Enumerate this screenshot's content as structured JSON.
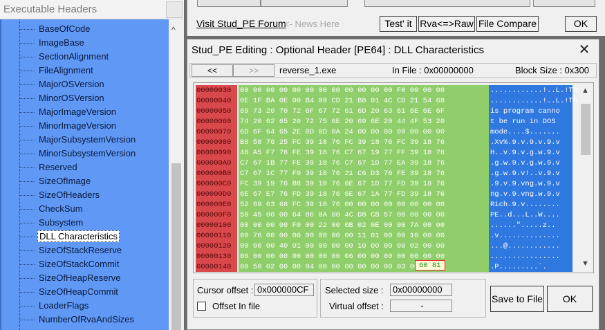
{
  "left_panel": {
    "header": "Executable Headers",
    "tree_items": [
      "BaseOfCode",
      "ImageBase",
      "SectionAlignment",
      "FileAlignment",
      "MajorOSVersion",
      "MinorOSVersion",
      "MajorImageVersion",
      "MinorImageVersion",
      "MajorSubsystemVersion",
      "MinorSubsystemVersion",
      "Reserved",
      "SizeOfImage",
      "SizeOfHeaders",
      "CheckSum",
      "Subsystem",
      "DLL Characteristics",
      "SizeOfStackReserve",
      "SizeOfStackCommit",
      "SizeOfHeapReserve",
      "SizeOfHeapCommit",
      "LoaderFlags",
      "NumberOfRvaAndSizes"
    ],
    "selected_item": "DLL Characteristics",
    "scroll_up_glyph": "^"
  },
  "main_window": {
    "forum_link": "Visit Stud_PE Forum",
    "news_text": "<- News Here",
    "buttons": {
      "test_it": "Test' it",
      "rva_raw": "Rva<=>Raw",
      "file_compare": "File Compare",
      "ok": "OK"
    }
  },
  "dialog": {
    "title": "Stud_PE Editing : Optional Header [PE64] : DLL Characteristics",
    "close_glyph": "✕",
    "nav_prev": "<<",
    "nav_next": ">>",
    "file_name": "reverse_1.exe",
    "in_file": "In File : 0x00000000",
    "block_size": "Block Size : 0x300",
    "hex_rows": [
      {
        "off": "00000030",
        "hex": "00 00 00 00 00 00 00 00 00 00 00 00 F0 00 00 00",
        "asc": "............!..L.!Th"
      },
      {
        "off": "00000040",
        "hex": "0E 1F BA 0E 00 B4 09 CD 21 B8 01 4C CD 21 54 68",
        "asc": "............!..L.!Th"
      },
      {
        "off": "00000050",
        "hex": "69 73 20 70 72 6F 67 72 61 6D 20 63 61 6E 6E 6F",
        "asc": "is program canno"
      },
      {
        "off": "00000060",
        "hex": "74 20 62 65 20 72 75 6E 20 69 6E 20 44 4F 53 20",
        "asc": "t be run in DOS "
      },
      {
        "off": "00000070",
        "hex": "6D 6F 64 65 2E 0D 0D 0A 24 00 00 00 00 00 00 00",
        "asc": "mode....$......."
      },
      {
        "off": "00000080",
        "hex": "B8 58 76 25 FC 39 18 76 FC 39 18 76 FC 39 18 76",
        "asc": ".Xv%.9.v.9.v.9.v"
      },
      {
        "off": "00000090",
        "hex": "48 A5 F7 76 FE 39 18 76 C7 67 19 77 FF 39 18 76",
        "asc": "H..v.9.v.g.w.9.v"
      },
      {
        "off": "000000A0",
        "hex": "C7 67 1B 77 FE 39 18 76 C7 67 1D 77 EA 39 18 76",
        "asc": ".g.w.9.v.g.w.9.v"
      },
      {
        "off": "000000B0",
        "hex": "C7 67 1C 77 F0 39 18 76 21 C6 D3 76 FE 39 18 76",
        "asc": ".g.w.9.v!..v.9.v"
      },
      {
        "off": "000000C0",
        "hex": "FC 39 19 76 B8 39 18 76 6E 67 1D 77 FD 39 18 76",
        "asc": ".9.v.9.vng.w.9.v"
      },
      {
        "off": "000000D0",
        "hex": "6E 67 E7 76 FD 39 18 76 6E 67 1A 77 FD 39 18 76",
        "asc": "ng.v.9.vng.w.9.v"
      },
      {
        "off": "000000E0",
        "hex": "52 69 63 68 FC 39 18 76 00 00 00 00 00 00 00 00",
        "asc": "Rich.9.v........"
      },
      {
        "off": "000000F0",
        "hex": "50 45 00 00 64 86 0A 00 4C D8 CB 57 00 00 00 00",
        "asc": "PE..d...L..W...."
      },
      {
        "off": "00000100",
        "hex": "00 00 00 00 F0 00 22 00 0B 02 0E 00 00 7A 00 00",
        "asc": "......\".....z.."
      },
      {
        "off": "00000110",
        "hex": "00 76 00 00 00 00 00 00 00 11 01 00 00 10 00 00",
        "asc": ".v.............."
      },
      {
        "off": "00000120",
        "hex": "00 00 00 40 01 00 00 00 00 10 00 00 00 02 00 00",
        "asc": "...@............"
      },
      {
        "off": "00000130",
        "hex": "06 00 00 00 00 00 00 00 06 00 00 00 00 00 00 00",
        "asc": "................"
      },
      {
        "off": "00000140",
        "hex": "00 50 02 00 00 04 00 00 00 00 00 00 03 00",
        "asc": ".P.........`."
      }
    ],
    "selected_bytes": "60 81",
    "cursor_offset_label": "Cursor offset :",
    "cursor_offset_value": "0x000000CF",
    "offset_in_file_label": "Offset In file",
    "selected_size_label": "Selected size :",
    "selected_size_value": "0x00000000",
    "virtual_offset_label": "Virtual offset :",
    "virtual_offset_value": "-",
    "save_to_file": "Save to File",
    "ok": "OK"
  },
  "colors": {
    "tree_bg": "#5f98f5",
    "offset_col": "#d9484a",
    "hex_col": "#8fce6a",
    "ascii_col": "#2f78e0"
  }
}
